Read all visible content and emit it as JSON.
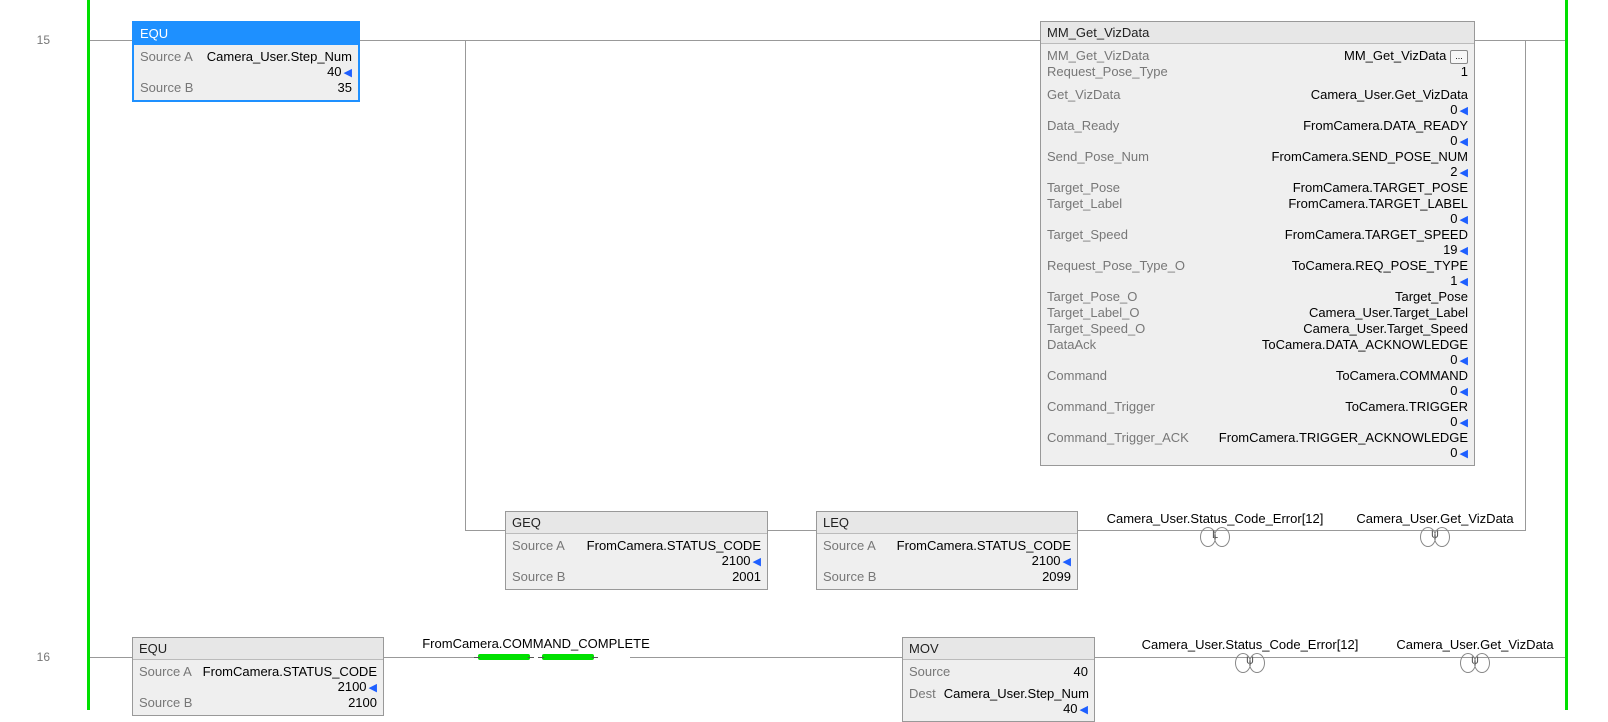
{
  "rungs": {
    "r15": "15",
    "r16": "16"
  },
  "equ15": {
    "title": "EQU",
    "srcA_label": "Source A",
    "srcA_val": "Camera_User.Step_Num",
    "srcA_live": "40",
    "srcB_label": "Source B",
    "srcB_val": "35"
  },
  "mm": {
    "title": "MM_Get_VizData",
    "rows": [
      {
        "label": "MM_Get_VizData",
        "val": "MM_Get_VizData",
        "btn": true
      },
      {
        "label": "Request_Pose_Type",
        "val": "1"
      },
      {
        "label": "Get_VizData",
        "val": "Camera_User.Get_VizData",
        "live": "0",
        "gap": true
      },
      {
        "label": "Data_Ready",
        "val": "FromCamera.DATA_READY",
        "live": "0"
      },
      {
        "label": "Send_Pose_Num",
        "val": "FromCamera.SEND_POSE_NUM",
        "live": "2"
      },
      {
        "label": "Target_Pose",
        "val": "FromCamera.TARGET_POSE"
      },
      {
        "label": "Target_Label",
        "val": "FromCamera.TARGET_LABEL",
        "live": "0"
      },
      {
        "label": "Target_Speed",
        "val": "FromCamera.TARGET_SPEED",
        "live": "19"
      },
      {
        "label": "Request_Pose_Type_O",
        "val": "ToCamera.REQ_POSE_TYPE",
        "live": "1"
      },
      {
        "label": "Target_Pose_O",
        "val": "Target_Pose"
      },
      {
        "label": "Target_Label_O",
        "val": "Camera_User.Target_Label"
      },
      {
        "label": "Target_Speed_O",
        "val": "Camera_User.Target_Speed"
      },
      {
        "label": "DataAck",
        "val": "ToCamera.DATA_ACKNOWLEDGE",
        "live": "0"
      },
      {
        "label": "Command",
        "val": "ToCamera.COMMAND",
        "live": "0"
      },
      {
        "label": "Command_Trigger",
        "val": "ToCamera.TRIGGER",
        "live": "0"
      },
      {
        "label": "Command_Trigger_ACK",
        "val": "FromCamera.TRIGGER_ACKNOWLEDGE",
        "live": "0"
      }
    ]
  },
  "geq": {
    "title": "GEQ",
    "srcA_label": "Source A",
    "srcA_val": "FromCamera.STATUS_CODE",
    "srcA_live": "2100",
    "srcB_label": "Source B",
    "srcB_val": "2001"
  },
  "leq": {
    "title": "LEQ",
    "srcA_label": "Source A",
    "srcA_val": "FromCamera.STATUS_CODE",
    "srcA_live": "2100",
    "srcB_label": "Source B",
    "srcB_val": "2099"
  },
  "coils15": {
    "a": {
      "label": "Camera_User.Status_Code_Error[12]",
      "letter": "L"
    },
    "b": {
      "label": "Camera_User.Get_VizData",
      "letter": "U"
    }
  },
  "equ16": {
    "title": "EQU",
    "srcA_label": "Source A",
    "srcA_val": "FromCamera.STATUS_CODE",
    "srcA_live": "2100",
    "srcB_label": "Source B",
    "srcB_val": "2100"
  },
  "contact16": {
    "label": "FromCamera.COMMAND_COMPLETE"
  },
  "mov": {
    "title": "MOV",
    "src_label": "Source",
    "src_val": "40",
    "dest_label": "Dest",
    "dest_val": "Camera_User.Step_Num",
    "dest_live": "40"
  },
  "coils16": {
    "a": {
      "label": "Camera_User.Status_Code_Error[12]",
      "letter": "U"
    },
    "b": {
      "label": "Camera_User.Get_VizData",
      "letter": "U"
    }
  }
}
